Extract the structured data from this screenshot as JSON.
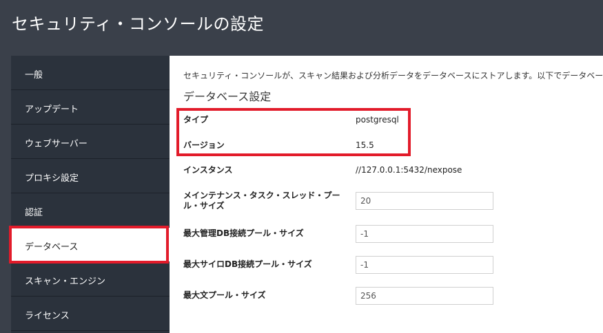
{
  "header": {
    "title": "セキュリティ・コンソールの設定"
  },
  "sidebar": {
    "items": [
      {
        "label": "一般"
      },
      {
        "label": "アップデート"
      },
      {
        "label": "ウェブサーバー"
      },
      {
        "label": "プロキシ設定"
      },
      {
        "label": "認証"
      },
      {
        "label": "データベース",
        "active": true
      },
      {
        "label": "スキャン・エンジン"
      },
      {
        "label": "ライセンス"
      }
    ]
  },
  "main": {
    "intro": "セキュリティ・コンソールが、スキャン結果および分析データをデータベースにストアします。以下でデータベース設定を休",
    "section_title": "データベース設定",
    "type": {
      "label": "タイプ",
      "value": "postgresql"
    },
    "version": {
      "label": "バージョン",
      "value": "15.5"
    },
    "instance": {
      "label": "インスタンス",
      "value": "//127.0.0.1:5432/nexpose"
    },
    "maintenance_pool": {
      "label": "メインテナンス・タスク・スレッド・プール・サイズ",
      "value": "20"
    },
    "max_admin_db_pool": {
      "label": "最大管理DB接続プール・サイズ",
      "value": "-1"
    },
    "max_silo_db_pool": {
      "label": "最大サイロDB接続プール・サイズ",
      "value": "-1"
    },
    "max_statement_pool": {
      "label": "最大文プール・サイズ",
      "value": "256"
    }
  },
  "colors": {
    "header_bg": "#3a404a",
    "sidebar_bg": "#2b323c",
    "highlight": "#e21b2a"
  }
}
